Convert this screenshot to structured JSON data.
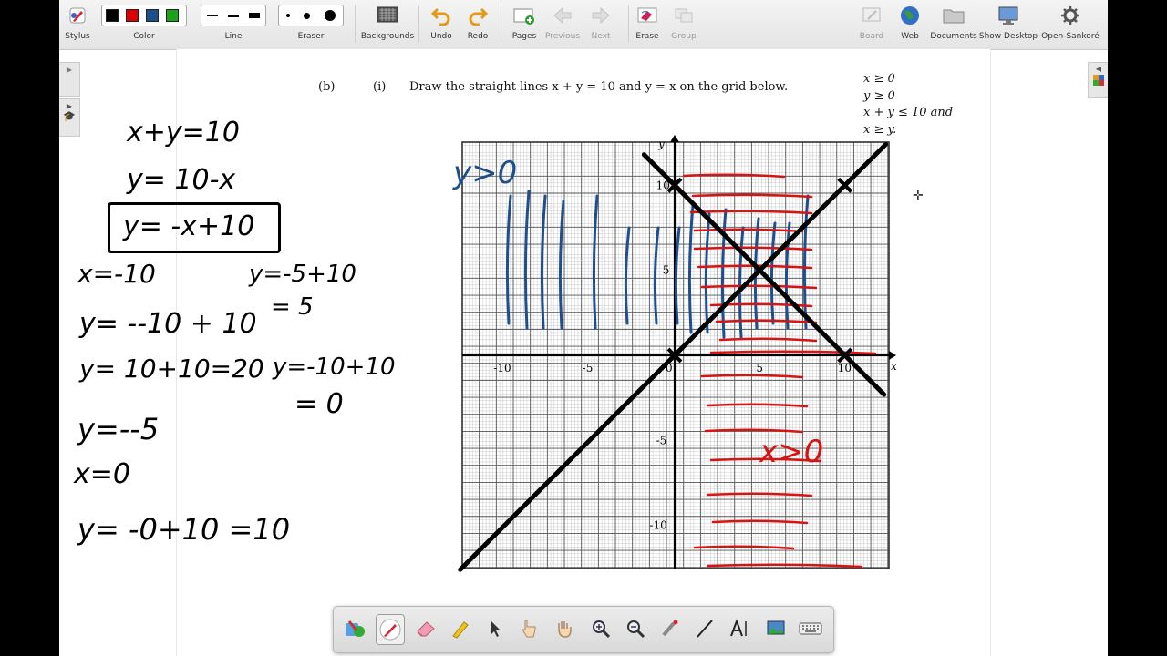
{
  "toolbar": {
    "stylus": "Stylus",
    "color": "Color",
    "line": "Line",
    "eraser": "Eraser",
    "backgrounds": "Backgrounds",
    "undo": "Undo",
    "redo": "Redo",
    "pages": "Pages",
    "previous": "Previous",
    "next": "Next",
    "erase": "Erase",
    "group": "Group",
    "board": "Board",
    "web": "Web",
    "documents": "Documents",
    "show_desktop": "Show Desktop",
    "open_sankore": "Open-Sankoré",
    "colors": [
      "#000000",
      "#e00000",
      "#1f4e8c",
      "#1aa31a"
    ]
  },
  "question": {
    "part": "(b)",
    "sub": "(i)",
    "instruction": "Draw the straight lines x + y = 10 and y = x on the grid below.",
    "conditions": [
      "x ≥ 0",
      "y ≥ 0",
      "x + y ≤ 10 and",
      "x ≥ y."
    ]
  },
  "graph": {
    "y_label": "y",
    "x_label": "x",
    "x_ticks": [
      "-10",
      "-5",
      "0",
      "5",
      "10"
    ],
    "y_ticks": [
      "10",
      "5",
      "-5",
      "-10"
    ]
  },
  "handwriting": {
    "left": [
      "x+y=10",
      "y= 10-x",
      "y= -x+10",
      "x=-10",
      "y= --10 + 10",
      "y= 10+10=20",
      "y=--5",
      "x=0",
      "y= -0+10 =10"
    ],
    "middle": [
      "y=-5+10",
      "= 5",
      "y=-10+10",
      "= 0"
    ],
    "graph_blue": "y>0",
    "graph_red": "x>0"
  },
  "colors": {
    "ink_blue": "#1f4e8c",
    "ink_red": "#d61414",
    "ink_black": "#000000"
  }
}
